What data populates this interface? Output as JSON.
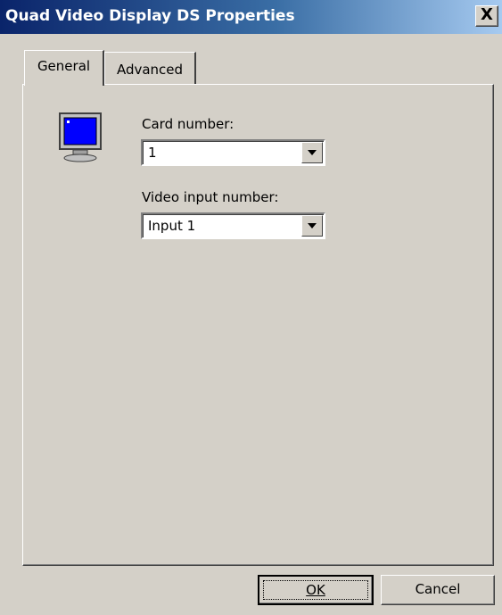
{
  "window": {
    "title": "Quad Video Display DS Properties",
    "close_label": "X"
  },
  "tabs": [
    {
      "label": "General",
      "active": true
    },
    {
      "label": "Advanced",
      "active": false
    }
  ],
  "general": {
    "card_number_label": "Card number:",
    "card_number_value": "1",
    "video_input_label": "Video input number:",
    "video_input_value": "Input 1"
  },
  "buttons": {
    "ok": "OK",
    "cancel": "Cancel"
  },
  "icons": {
    "monitor": "monitor-icon"
  }
}
